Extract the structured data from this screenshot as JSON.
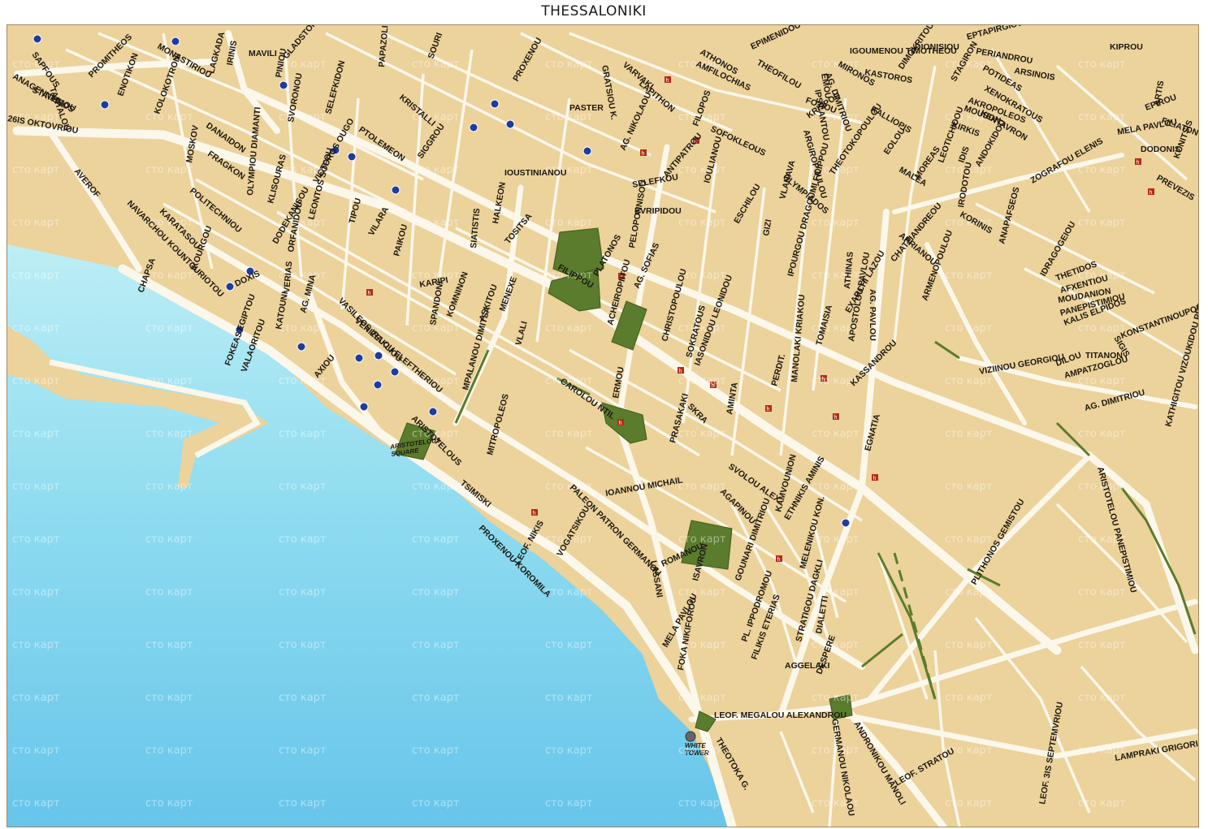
{
  "map": {
    "title": "THESSALONIKI",
    "watermark_text": "сто карт",
    "colors": {
      "land": "#ecd29b",
      "road": "#fbf7ea",
      "sea_light": "#b5eaf4",
      "sea_dark": "#6ec8ea",
      "park": "#5a7c2c",
      "park_edge": "#3e5a1a",
      "metro": "#1f3c9c",
      "hotel": "#b52b18"
    },
    "landmarks": [
      {
        "id": "aristotelous-square",
        "label": "ARISTOTELOUS SQUARE"
      },
      {
        "id": "white-tower",
        "label": "WHITE TOWER"
      }
    ],
    "streets": [
      "THESSALONIKI",
      "SAPFOUS",
      "TANTALOU",
      "PROMITHEOS",
      "ENOTIKON",
      "MONASTIRIOU",
      "KOLOKOTRONI",
      "LAGKADA",
      "IRINIS",
      "MAVILI",
      "PINIOU",
      "GLADSTONOS",
      "PAPAZOLI",
      "SOURI",
      "PROXENOU",
      "ANAGENNISEOS",
      "STATHMOU",
      "26IS OKTOVRIOU",
      "DANAIDON",
      "MOSKOV",
      "FRAGKON",
      "SVORONOU",
      "SELEFKIDON",
      "KRISTALLI",
      "SIGGROU",
      "PTOLEMEON",
      "PASTER",
      "GRATSIOU K.",
      "VARVAKI",
      "LAPITHON",
      "AMFILOCHIAS",
      "ATHONOS",
      "EPIMENIDOU",
      "THEOFILOU",
      "IGOUMENOU TIMOTHEOU",
      "MIRONOS",
      "KASTOROS",
      "DIMOKRITOU",
      "DIONISIOU",
      "EPTAPIRGIOU",
      "PERIANDROU",
      "POTIDEAS",
      "ARSINOIS",
      "KIPROU",
      "STAGIRON",
      "AKROPOLEOS",
      "XENOKRATOUS",
      "KENTAVRON",
      "MOUSON",
      "KIRKIS",
      "ARTIS",
      "EPIROU",
      "FILIATON",
      "MELA PAVLOU",
      "DODONIS",
      "KONITSIS",
      "PREVEZIS",
      "ZOGRAFOU ELENIS",
      "KALLIOPIS",
      "EOLOU",
      "MALEA",
      "MOREAS",
      "LEOTICHIDOU",
      "IDIS",
      "IRODOTOU",
      "ANDOKIDOU",
      "KORINIS",
      "ANAPAFSEOS",
      "IDRAGOGEIOU",
      "THETIDOS",
      "AFXENTIOU",
      "MOUDANION",
      "PANEPISTIMIOU",
      "KALIS ELPIDOS",
      "KONSTANTINOUPOLEOS",
      "SIGIS",
      "DILOU",
      "TITANON",
      "VIZIINOU GEORGIOU",
      "AMPATZOGLOU",
      "KATHIGITOU VIZOUKIDOU PER.",
      "AG. DIMITRIOU",
      "ARISTOTELOU PANEPISTIMIOU",
      "PLITHONOS GEMISTOU",
      "LAMPRAKI GRIGORIOU",
      "LEOF. 3IS SEPTEMVRIOU",
      "LEOF. STRATOU",
      "ANDRONIKOU MANOLI",
      "GERMANOU NIKOLAOU",
      "LEOF. MEGALOU ALEXANDROU",
      "THEOTOKA G.",
      "AGGELAKI",
      "DESPERE",
      "DIALETTI",
      "STRATIGOU DAGKLI",
      "FILIKIS ETERIAS",
      "PL. IPPODROMOU",
      "GOUNARI DIMITRIOU",
      "ISAVRON",
      "ROMANOU",
      "FOKA NIKIFOROU",
      "MELA PAVLOU",
      "LASSANI",
      "VOGATSIKOU",
      "LEOF. NIKIS",
      "PROXENOU KOROMILA",
      "TSIMISKI",
      "PALEON PATRON GERMANOU",
      "IOANNOU MICHAIL",
      "SVOLOU ALEX.",
      "AGAPINOU",
      "KAMVOUNION",
      "ETHNIKIS AMINIS",
      "MELENIKOU KON.",
      "EGNATIA",
      "SKRA",
      "PRASAKAKI",
      "ERMOU",
      "CAROLOU NTIL",
      "MITROPOLEOS",
      "ARISTOTELOUS",
      "MPALANOU DIMITSA",
      "VLALI",
      "MENEXE",
      "ASKITOU",
      "KOMNINON",
      "SPANDONI",
      "KARIPI",
      "PAIKOU",
      "VILARA",
      "TIPOU",
      "LEONTOS SOFOU",
      "DODEKANISOU",
      "OLYMPIOU DIAMANTI",
      "POLITECHNIOU",
      "KARATASOU",
      "NAVARCHOU KOUNTOURIOTOU",
      "AVEROF",
      "CHAPSA",
      "IKOURGOU",
      "DOXIS",
      "EGIPTOU",
      "KATOUNI",
      "AG. MINA",
      "VASILEOS IRAKLIOU",
      "VENIZELOU ELEFTHERIOU",
      "AXIOU",
      "FOKEAS",
      "VALAORITOU",
      "VICTOROS OUGO",
      "VERIAS",
      "ORFANIDOU",
      "KLISOURAS",
      "SIATISTIS",
      "HALKEON",
      "TOSITSA",
      "IOUSTINIANOU",
      "FILIPPOU",
      "PLATONOS",
      "AG. SOFIAS",
      "ACHEIROPIITOU",
      "CHRISTOPOULOU",
      "SOKRATOUS",
      "IASONIDOU LEONIDOU",
      "AMINTA",
      "PELOPONNISOU",
      "EVRIPIDOU",
      "ESCHILOU",
      "GIZI",
      "VLAHAVA",
      "OLYMPIADOS",
      "ARGIROPOULOU",
      "THEOTOKOPOULOU",
      "KRISPOU",
      "FOTIOU",
      "IPSILANTOU",
      "EMOU",
      "AG. DIMITRIOU",
      "SELEFKOU",
      "AG. NIKOLAOU",
      "ANTIPATROU",
      "FILOPOS",
      "SOFOKLEOUS",
      "IOULIANOU",
      "IPOURGOU DRAGOUMI FILIPPOU",
      "MANOLAKI KRIAKOU",
      "APOSTOLOU PAVLOU",
      "TOMAISIA",
      "EXARCHI LAZOU",
      "AG. PAVLOU",
      "ATHINAS",
      "CHATZIANDREOU",
      "ARRIANOU",
      "ARMENOPOULOU",
      "PERDIT.",
      "KASSANDROU"
    ]
  }
}
